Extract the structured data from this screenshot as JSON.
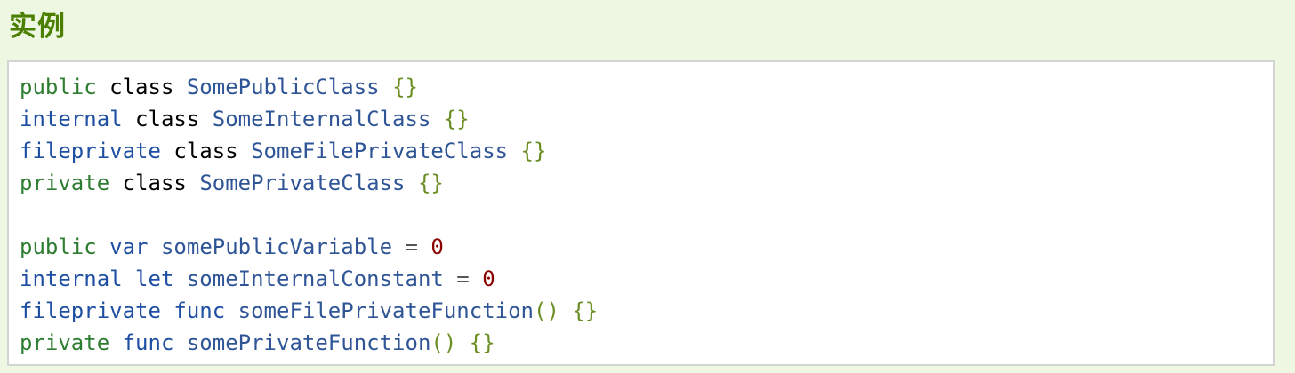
{
  "heading": "实例",
  "code_lines": [
    {
      "tokens": [
        "public",
        "class",
        "SomePublicClass",
        "{}"
      ]
    },
    {
      "tokens": [
        "internal",
        "class",
        "SomeInternalClass",
        "{}"
      ]
    },
    {
      "tokens": [
        "fileprivate",
        "class",
        "SomeFilePrivateClass",
        "{}"
      ]
    },
    {
      "tokens": [
        "private",
        "class",
        "SomePrivateClass",
        "{}"
      ]
    },
    {
      "tokens": []
    },
    {
      "tokens": [
        "public",
        "var",
        "somePublicVariable",
        "=",
        "0"
      ]
    },
    {
      "tokens": [
        "internal",
        "let",
        "someInternalConstant",
        "=",
        "0"
      ]
    },
    {
      "tokens": [
        "fileprivate",
        "func",
        "someFilePrivateFunction",
        "()",
        "{}"
      ]
    },
    {
      "tokens": [
        "private",
        "func",
        "somePrivateFunction",
        "()",
        "{}"
      ]
    }
  ],
  "colors": {
    "page_background": "#eef7e2",
    "heading": "#4a7f00",
    "keyword_access": "#2e7d32",
    "keyword_declaration": "#1f4fa3",
    "identifier": "#2f5597",
    "braces": "#6b8e23",
    "number": "#8b0000"
  }
}
